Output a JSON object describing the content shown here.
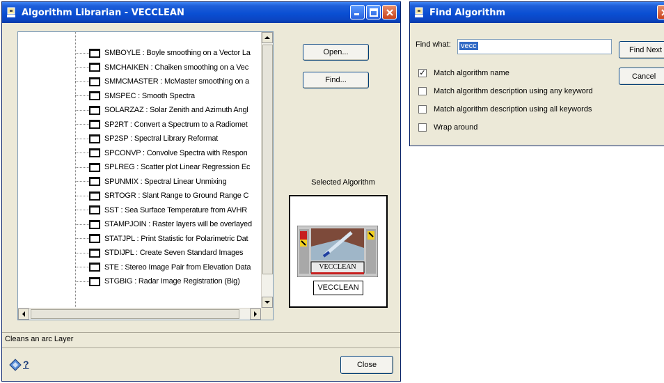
{
  "librarian": {
    "title": "Algorithm Librarian - VECCLEAN",
    "items": [
      {
        "label": "SMBOYLE : Boyle smoothing on a Vector La"
      },
      {
        "label": "SMCHAIKEN : Chaiken smoothing on a Vec"
      },
      {
        "label": "SMMCMASTER : McMaster smoothing on a"
      },
      {
        "label": "SMSPEC : Smooth Spectra"
      },
      {
        "label": "SOLARZAZ : Solar Zenith and Azimuth Angl"
      },
      {
        "label": "SP2RT : Convert a Spectrum to a Radiomet"
      },
      {
        "label": "SP2SP : Spectral Library Reformat"
      },
      {
        "label": "SPCONVP : Convolve Spectra with Respon"
      },
      {
        "label": "SPLREG : Scatter plot Linear Regression Ec"
      },
      {
        "label": "SPUNMIX : Spectral Linear Unmixing"
      },
      {
        "label": "SRTOGR : Slant Range to Ground Range C"
      },
      {
        "label": "SST : Sea Surface Temperature from AVHR"
      },
      {
        "label": "STAMPJOIN : Raster layers will be overlayed"
      },
      {
        "label": "STATJPL : Print Statistic for Polarimetric Dat"
      },
      {
        "label": "STDIJPL : Create Seven Standard Images"
      },
      {
        "label": "STE : Stereo Image Pair from Elevation Data"
      },
      {
        "label": "STGBIG : Radar Image Registration (Big)"
      }
    ],
    "open_label": "Open...",
    "find_label": "Find...",
    "selected_algorithm_label": "Selected Algorithm",
    "selected_algorithm_name": "VECCLEAN",
    "icon_caption": "VECCLEAN",
    "status_text": "Cleans an arc Layer",
    "close_label": "Close",
    "help_icon_text": "?",
    "icons": {
      "item": "algorithm-item-icon",
      "help": "help-icon",
      "preview": "vecclean-algorithm-icon"
    }
  },
  "find_dialog": {
    "title": "Find Algorithm",
    "find_what_label": "Find what:",
    "find_what_value": "vecc",
    "find_next_label": "Find Next",
    "cancel_label": "Cancel",
    "options": [
      {
        "label": "Match algorithm name",
        "checked": true
      },
      {
        "label": "Match algorithm description using any keyword",
        "checked": false
      },
      {
        "label": "Match algorithm description using all keywords",
        "checked": false
      },
      {
        "label": "Wrap around",
        "checked": false
      }
    ]
  },
  "colors": {
    "titlebar": "#0a4fd3",
    "window_face": "#ece9d8",
    "selection": "#316ac5",
    "close_button": "#c9431c"
  }
}
